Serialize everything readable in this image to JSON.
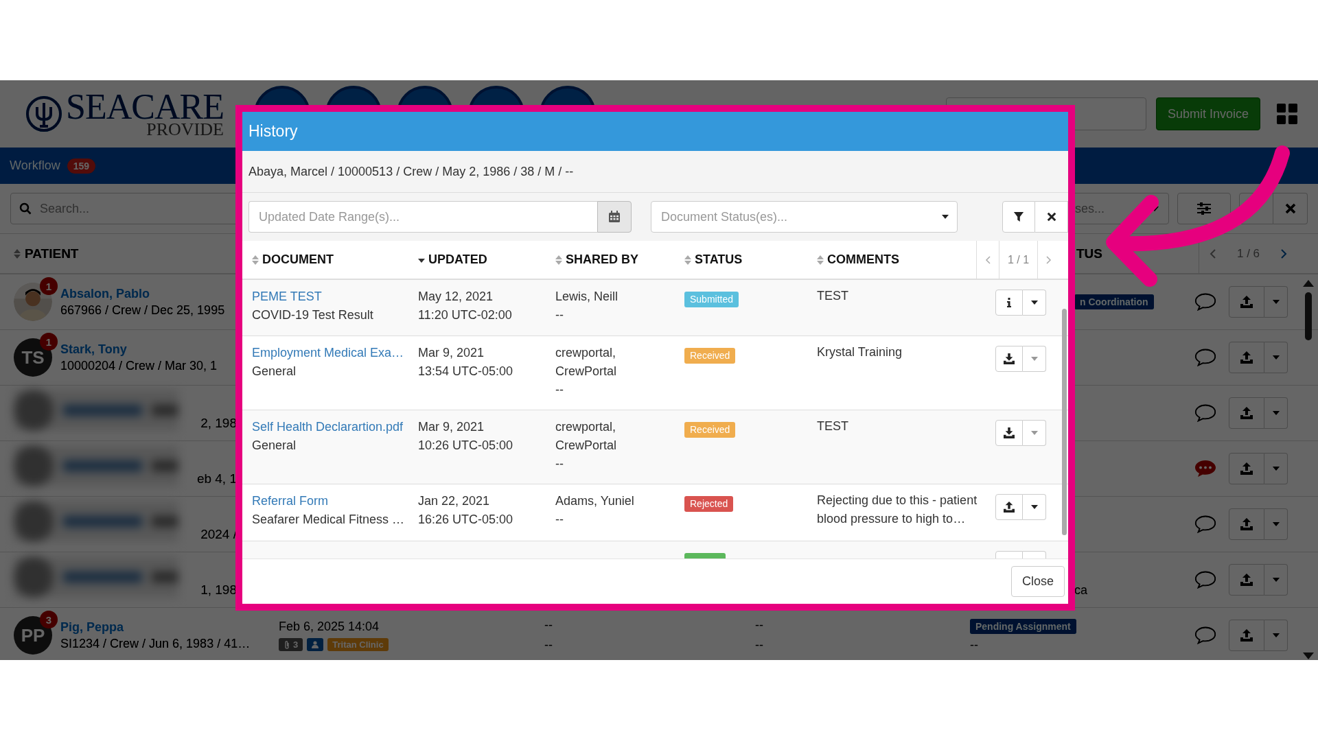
{
  "app": {
    "logo": {
      "title": "SEACARE",
      "subtitle": "PROVIDE"
    },
    "submit_button": "Submit Invoice",
    "nav": {
      "label": "Workflow",
      "count": "159"
    },
    "search": {
      "placeholder": "Search..."
    },
    "status_filter": {
      "placeholder": "ses..."
    },
    "columns": {
      "patient": "PATIENT",
      "status": "TUS"
    },
    "pager": "1 / 6",
    "rows": [
      {
        "badge": "1",
        "name": "Absalon, Pablo",
        "details": "667966 / Crew / Dec 25, 1995",
        "status": "n Coordination",
        "unread": false
      },
      {
        "kind": "initials",
        "initials": "TS",
        "badge": "1",
        "name": "Stark, Tony",
        "details": "10000204 / Crew / Mar 30, 1",
        "unread": false
      },
      {
        "kind": "blurred",
        "fragment": "2, 198",
        "unread": false
      },
      {
        "kind": "blurred",
        "fragment": "eb 4, 1",
        "unread": true
      },
      {
        "kind": "blurred",
        "fragment": "2024 /",
        "unread": false
      },
      {
        "kind": "blurred",
        "fragment": "1, 198",
        "status_note": "ca",
        "unread": false
      },
      {
        "kind": "initials",
        "initials": "PP",
        "badge": "3",
        "name": "Pig, Peppa",
        "details": "SI1234 / Crew / Jun 6, 1983 / 41…",
        "updated": "Feb 6, 2025 14:04",
        "attachments": "3",
        "clinic": "Tritan Clinic",
        "cells": [
          [
            "--",
            "--"
          ],
          [
            "--",
            "--"
          ]
        ],
        "status": "Pending Assignment",
        "status_note": "--",
        "unread": false
      }
    ]
  },
  "modal": {
    "title": "History",
    "patient": "Abaya, Marcel / 10000513 / Crew / May 2, 1986 / 38 / M / --",
    "date_filter": {
      "placeholder": "Updated Date Range(s)..."
    },
    "status_filter": {
      "placeholder": "Document Status(es)..."
    },
    "columns": [
      {
        "label": "DOCUMENT",
        "sorted": false
      },
      {
        "label": "UPDATED",
        "sorted": true
      },
      {
        "label": "SHARED BY",
        "sorted": false
      },
      {
        "label": "STATUS",
        "sorted": false
      },
      {
        "label": "COMMENTS",
        "sorted": false
      }
    ],
    "pager": "1 / 1",
    "documents": [
      {
        "title": "PEME TEST",
        "type": "COVID-19 Test Result",
        "date": "May 12, 2021",
        "time": "11:20 UTC-02:00",
        "shared_by": [
          "Lewis, Neill",
          "--"
        ],
        "status": {
          "label": "Submitted",
          "kind": "submitted"
        },
        "comment": "TEST",
        "kind": "info",
        "menu_disabled": false
      },
      {
        "title": "Employment Medical Exa…",
        "type": "General",
        "date": "Mar 9, 2021",
        "time": "13:54 UTC-05:00",
        "shared_by": [
          "crewportal,",
          "CrewPortal",
          "--"
        ],
        "status": {
          "label": "Received",
          "kind": "received"
        },
        "comment": "Krystal Training",
        "kind": "download",
        "menu_disabled": true
      },
      {
        "title": "Self Health Declarartion.pdf",
        "type": "General",
        "date": "Mar 9, 2021",
        "time": "10:26 UTC-05:00",
        "shared_by": [
          "crewportal,",
          "CrewPortal",
          "--"
        ],
        "status": {
          "label": "Received",
          "kind": "received"
        },
        "comment": "TEST",
        "kind": "download",
        "menu_disabled": true
      },
      {
        "title": "Referral Form",
        "type": "Seafarer Medical Fitness …",
        "date": "Jan 22, 2021",
        "time": "16:26 UTC-05:00",
        "shared_by": [
          "Adams, Yuniel",
          "--"
        ],
        "status": {
          "label": "Rejected",
          "kind": "rejected"
        },
        "comment": "Rejecting due to this - patient blood pressure to high to…",
        "kind": "upload",
        "menu_disabled": false
      },
      {
        "status": {
          "kind": "accepted"
        }
      }
    ],
    "close_button": "Close"
  }
}
